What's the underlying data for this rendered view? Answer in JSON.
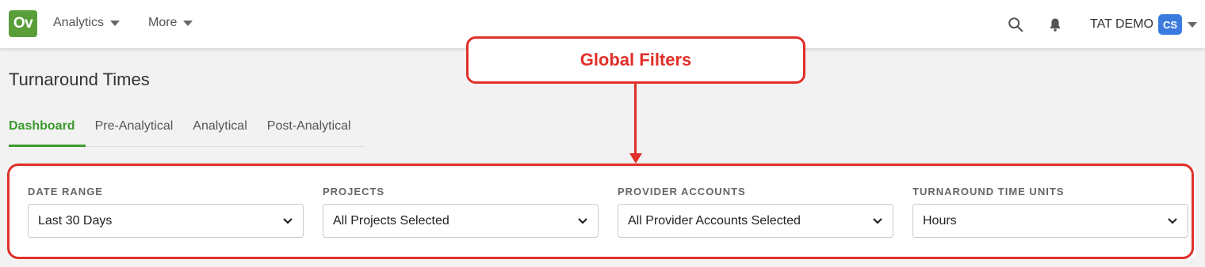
{
  "header": {
    "logo_text": "Ov",
    "menus": [
      {
        "label": "Analytics"
      },
      {
        "label": "More"
      }
    ],
    "user_name": "TAT DEMO",
    "user_initials": "CS"
  },
  "page": {
    "title": "Turnaround Times",
    "tabs": [
      {
        "label": "Dashboard",
        "active": true
      },
      {
        "label": "Pre-Analytical",
        "active": false
      },
      {
        "label": "Analytical",
        "active": false
      },
      {
        "label": "Post-Analytical",
        "active": false
      }
    ]
  },
  "filters": [
    {
      "label": "DATE RANGE",
      "value": "Last 30 Days"
    },
    {
      "label": "PROJECTS",
      "value": "All Projects Selected"
    },
    {
      "label": "PROVIDER ACCOUNTS",
      "value": "All Provider Accounts Selected"
    },
    {
      "label": "TURNAROUND TIME UNITS",
      "value": "Hours"
    }
  ],
  "annotation": {
    "label": "Global Filters",
    "color": "#e0302a"
  },
  "colors": {
    "brand_green": "#5a9e3a",
    "active_tab": "#3d9a2f",
    "avatar_blue": "#3b7be0"
  },
  "icons": [
    "search-icon",
    "bell-icon",
    "caret-down-icon",
    "chevron-down-icon"
  ]
}
